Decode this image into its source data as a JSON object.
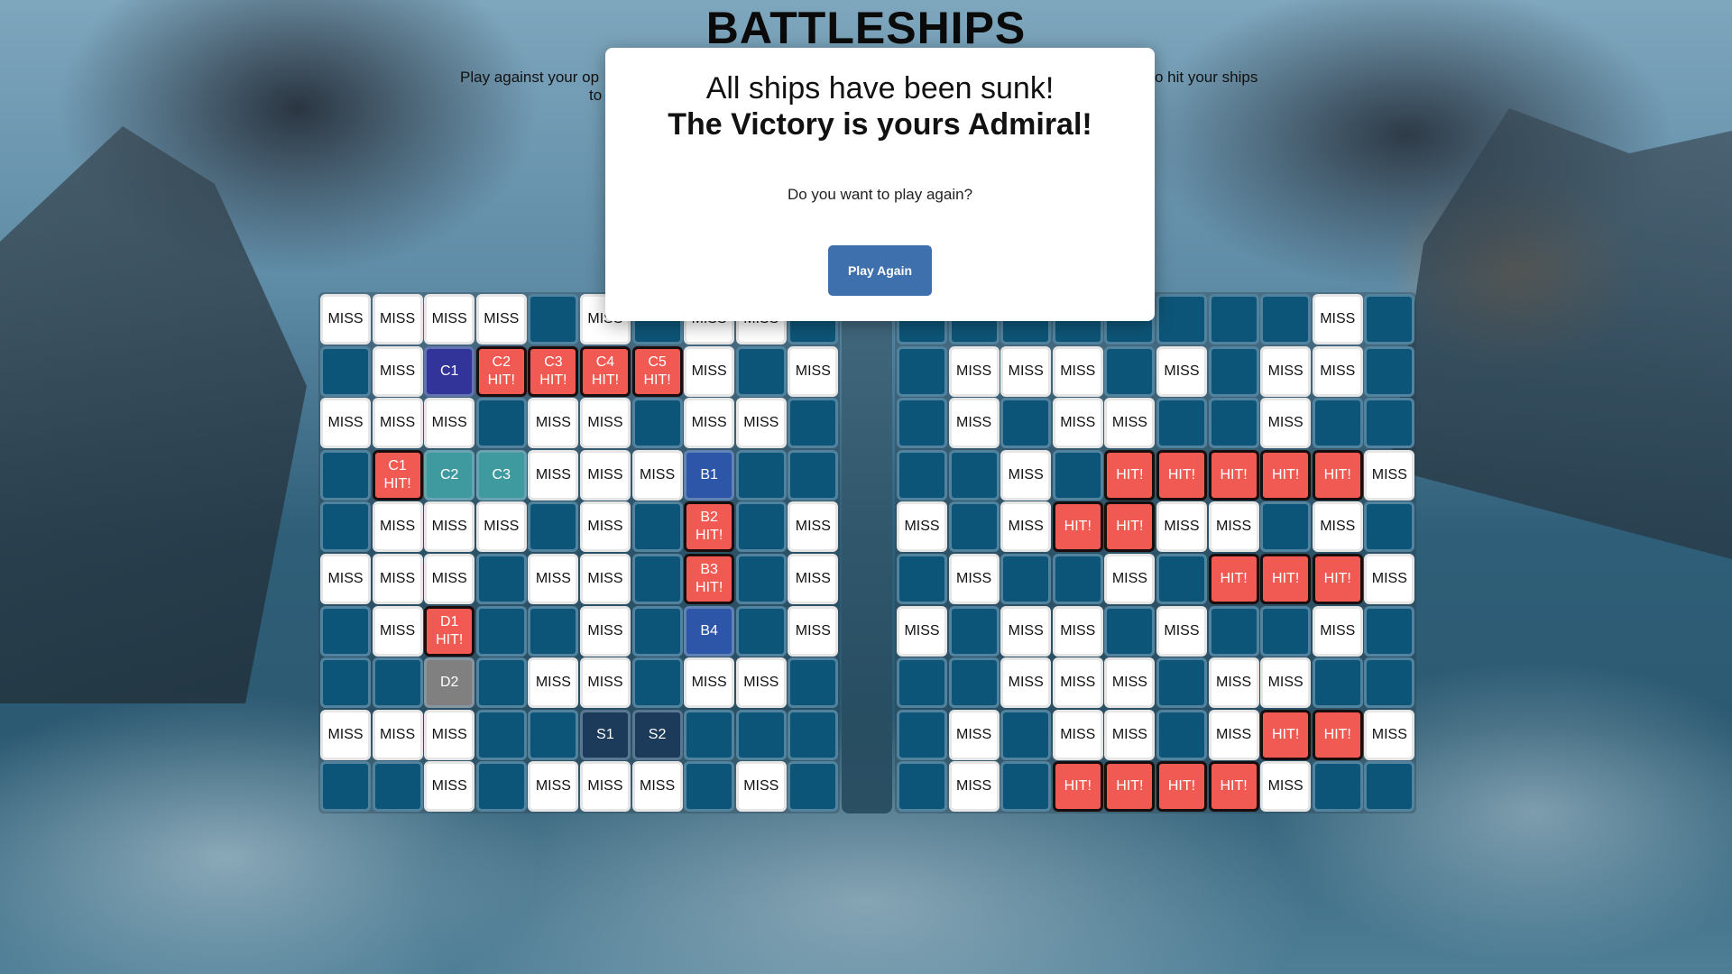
{
  "header": {
    "title": "BATTLESHIPS",
    "subtitle_left": "Play against your op",
    "subtitle_left2": "to",
    "subtitle_right": "o hit your ships"
  },
  "colors": {
    "water": "#0d5578",
    "miss": "#ffffff",
    "hit": "#f05a52",
    "button": "#3e70ad"
  },
  "modal": {
    "line1": "All ships have been sunk!",
    "line2": "The Victory is yours Admiral!",
    "question": "Do you want to play again?",
    "button_label": "Play Again"
  },
  "player_board": [
    [
      [
        "miss",
        "MISS"
      ],
      [
        "miss",
        "MISS"
      ],
      [
        "miss",
        "MISS"
      ],
      [
        "miss",
        "MISS"
      ],
      [
        "water",
        ""
      ],
      [
        "miss",
        "MISS"
      ],
      [
        "water",
        ""
      ],
      [
        "miss",
        "MISS"
      ],
      [
        "miss",
        "MISS"
      ],
      [
        "water",
        ""
      ]
    ],
    [
      [
        "water",
        ""
      ],
      [
        "miss",
        "MISS"
      ],
      [
        "ship-c1",
        "C1"
      ],
      [
        "hit",
        "C2\nHIT!"
      ],
      [
        "hit",
        "C3\nHIT!"
      ],
      [
        "hit",
        "C4\nHIT!"
      ],
      [
        "hit",
        "C5\nHIT!"
      ],
      [
        "miss",
        "MISS"
      ],
      [
        "water",
        ""
      ],
      [
        "miss",
        "MISS"
      ]
    ],
    [
      [
        "miss",
        "MISS"
      ],
      [
        "miss",
        "MISS"
      ],
      [
        "miss",
        "MISS"
      ],
      [
        "water",
        ""
      ],
      [
        "miss",
        "MISS"
      ],
      [
        "miss",
        "MISS"
      ],
      [
        "water",
        ""
      ],
      [
        "miss",
        "MISS"
      ],
      [
        "miss",
        "MISS"
      ],
      [
        "water",
        ""
      ]
    ],
    [
      [
        "water",
        ""
      ],
      [
        "hit",
        "C1\nHIT!"
      ],
      [
        "ship-c",
        "C2"
      ],
      [
        "ship-c",
        "C3"
      ],
      [
        "miss",
        "MISS"
      ],
      [
        "miss",
        "MISS"
      ],
      [
        "miss",
        "MISS"
      ],
      [
        "ship-b",
        "B1"
      ],
      [
        "water",
        ""
      ],
      [
        "water",
        ""
      ]
    ],
    [
      [
        "water",
        ""
      ],
      [
        "miss",
        "MISS"
      ],
      [
        "miss",
        "MISS"
      ],
      [
        "miss",
        "MISS"
      ],
      [
        "water",
        ""
      ],
      [
        "miss",
        "MISS"
      ],
      [
        "water",
        ""
      ],
      [
        "hit",
        "B2\nHIT!"
      ],
      [
        "water",
        ""
      ],
      [
        "miss",
        "MISS"
      ]
    ],
    [
      [
        "miss",
        "MISS"
      ],
      [
        "miss",
        "MISS"
      ],
      [
        "miss",
        "MISS"
      ],
      [
        "water",
        ""
      ],
      [
        "miss",
        "MISS"
      ],
      [
        "miss",
        "MISS"
      ],
      [
        "water",
        ""
      ],
      [
        "hit",
        "B3\nHIT!"
      ],
      [
        "water",
        ""
      ],
      [
        "miss",
        "MISS"
      ]
    ],
    [
      [
        "water",
        ""
      ],
      [
        "miss",
        "MISS"
      ],
      [
        "hit",
        "D1\nHIT!"
      ],
      [
        "water",
        ""
      ],
      [
        "water",
        ""
      ],
      [
        "miss",
        "MISS"
      ],
      [
        "water",
        ""
      ],
      [
        "ship-b",
        "B4"
      ],
      [
        "water",
        ""
      ],
      [
        "miss",
        "MISS"
      ]
    ],
    [
      [
        "water",
        ""
      ],
      [
        "water",
        ""
      ],
      [
        "ship-d",
        "D2"
      ],
      [
        "water",
        ""
      ],
      [
        "miss",
        "MISS"
      ],
      [
        "miss",
        "MISS"
      ],
      [
        "water",
        ""
      ],
      [
        "miss",
        "MISS"
      ],
      [
        "miss",
        "MISS"
      ],
      [
        "water",
        ""
      ]
    ],
    [
      [
        "miss",
        "MISS"
      ],
      [
        "miss",
        "MISS"
      ],
      [
        "miss",
        "MISS"
      ],
      [
        "water",
        ""
      ],
      [
        "water",
        ""
      ],
      [
        "ship-s",
        "S1"
      ],
      [
        "ship-s",
        "S2"
      ],
      [
        "water",
        ""
      ],
      [
        "water",
        ""
      ],
      [
        "water",
        ""
      ]
    ],
    [
      [
        "water",
        ""
      ],
      [
        "water",
        ""
      ],
      [
        "miss",
        "MISS"
      ],
      [
        "water",
        ""
      ],
      [
        "miss",
        "MISS"
      ],
      [
        "miss",
        "MISS"
      ],
      [
        "miss",
        "MISS"
      ],
      [
        "water",
        ""
      ],
      [
        "miss",
        "MISS"
      ],
      [
        "water",
        ""
      ]
    ]
  ],
  "enemy_board": [
    [
      [
        "water",
        ""
      ],
      [
        "water",
        ""
      ],
      [
        "water",
        ""
      ],
      [
        "water",
        ""
      ],
      [
        "water",
        ""
      ],
      [
        "water",
        ""
      ],
      [
        "water",
        ""
      ],
      [
        "water",
        ""
      ],
      [
        "miss",
        "MISS"
      ],
      [
        "water",
        ""
      ]
    ],
    [
      [
        "water",
        ""
      ],
      [
        "miss",
        "MISS"
      ],
      [
        "miss",
        "MISS"
      ],
      [
        "miss",
        "MISS"
      ],
      [
        "water",
        ""
      ],
      [
        "miss",
        "MISS"
      ],
      [
        "water",
        ""
      ],
      [
        "miss",
        "MISS"
      ],
      [
        "miss",
        "MISS"
      ],
      [
        "water",
        ""
      ]
    ],
    [
      [
        "water",
        ""
      ],
      [
        "miss",
        "MISS"
      ],
      [
        "water",
        ""
      ],
      [
        "miss",
        "MISS"
      ],
      [
        "miss",
        "MISS"
      ],
      [
        "water",
        ""
      ],
      [
        "water",
        ""
      ],
      [
        "miss",
        "MISS"
      ],
      [
        "water",
        ""
      ],
      [
        "water",
        ""
      ]
    ],
    [
      [
        "water",
        ""
      ],
      [
        "water",
        ""
      ],
      [
        "miss",
        "MISS"
      ],
      [
        "water",
        ""
      ],
      [
        "hit",
        "HIT!"
      ],
      [
        "hit",
        "HIT!"
      ],
      [
        "hit",
        "HIT!"
      ],
      [
        "hit",
        "HIT!"
      ],
      [
        "hit",
        "HIT!"
      ],
      [
        "miss",
        "MISS"
      ]
    ],
    [
      [
        "miss",
        "MISS"
      ],
      [
        "water",
        ""
      ],
      [
        "miss",
        "MISS"
      ],
      [
        "hit",
        "HIT!"
      ],
      [
        "hit",
        "HIT!"
      ],
      [
        "miss",
        "MISS"
      ],
      [
        "miss",
        "MISS"
      ],
      [
        "water",
        ""
      ],
      [
        "miss",
        "MISS"
      ],
      [
        "water",
        ""
      ]
    ],
    [
      [
        "water",
        ""
      ],
      [
        "miss",
        "MISS"
      ],
      [
        "water",
        ""
      ],
      [
        "water",
        ""
      ],
      [
        "miss",
        "MISS"
      ],
      [
        "water",
        ""
      ],
      [
        "hit",
        "HIT!"
      ],
      [
        "hit",
        "HIT!"
      ],
      [
        "hit",
        "HIT!"
      ],
      [
        "miss",
        "MISS"
      ]
    ],
    [
      [
        "miss",
        "MISS"
      ],
      [
        "water",
        ""
      ],
      [
        "miss",
        "MISS"
      ],
      [
        "miss",
        "MISS"
      ],
      [
        "water",
        ""
      ],
      [
        "miss",
        "MISS"
      ],
      [
        "water",
        ""
      ],
      [
        "water",
        ""
      ],
      [
        "miss",
        "MISS"
      ],
      [
        "water",
        ""
      ]
    ],
    [
      [
        "water",
        ""
      ],
      [
        "water",
        ""
      ],
      [
        "miss",
        "MISS"
      ],
      [
        "miss",
        "MISS"
      ],
      [
        "miss",
        "MISS"
      ],
      [
        "water",
        ""
      ],
      [
        "miss",
        "MISS"
      ],
      [
        "miss",
        "MISS"
      ],
      [
        "water",
        ""
      ],
      [
        "water",
        ""
      ]
    ],
    [
      [
        "water",
        ""
      ],
      [
        "miss",
        "MISS"
      ],
      [
        "water",
        ""
      ],
      [
        "miss",
        "MISS"
      ],
      [
        "miss",
        "MISS"
      ],
      [
        "water",
        ""
      ],
      [
        "miss",
        "MISS"
      ],
      [
        "hit",
        "HIT!"
      ],
      [
        "hit",
        "HIT!"
      ],
      [
        "miss",
        "MISS"
      ]
    ],
    [
      [
        "water",
        ""
      ],
      [
        "miss",
        "MISS"
      ],
      [
        "water",
        ""
      ],
      [
        "hit",
        "HIT!"
      ],
      [
        "hit",
        "HIT!"
      ],
      [
        "hit",
        "HIT!"
      ],
      [
        "hit",
        "HIT!"
      ],
      [
        "miss",
        "MISS"
      ],
      [
        "water",
        ""
      ],
      [
        "water",
        ""
      ]
    ]
  ]
}
